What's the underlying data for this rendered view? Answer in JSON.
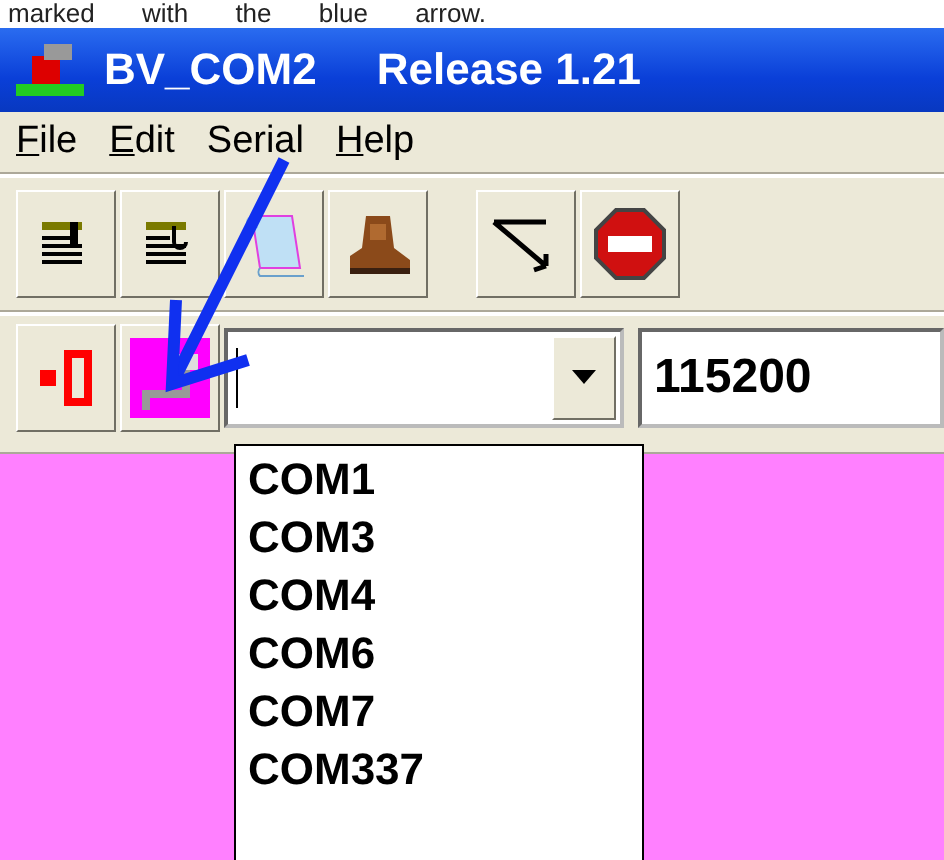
{
  "caption": "marked with the blue arrow.",
  "window": {
    "title": "BV_COM2",
    "release": "Release 1.21"
  },
  "menu": [
    {
      "label": "File",
      "mnemonic": true
    },
    {
      "label": "Edit",
      "mnemonic": true
    },
    {
      "label": "Serial",
      "mnemonic": false
    },
    {
      "label": "Help",
      "mnemonic": true
    }
  ],
  "baud_field": {
    "value": "115200"
  },
  "port_list": [
    {
      "label": "COM1",
      "selected": false
    },
    {
      "label": "COM3",
      "selected": false
    },
    {
      "label": "COM4",
      "selected": false
    },
    {
      "label": "COM6",
      "selected": false
    },
    {
      "label": "COM7",
      "selected": false
    },
    {
      "label": "COM337",
      "selected": false
    }
  ]
}
